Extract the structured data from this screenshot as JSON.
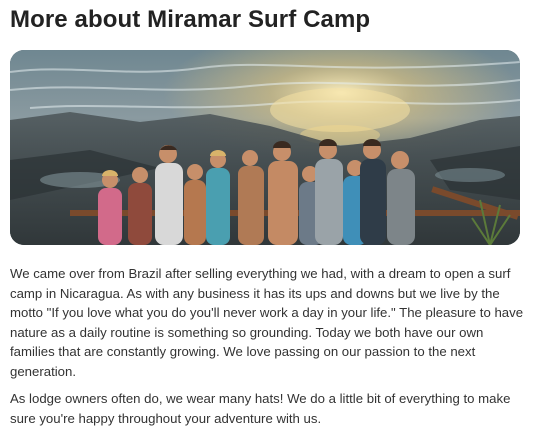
{
  "page": {
    "title": "More about Miramar Surf Camp"
  },
  "photo": {
    "subject": "group-photo"
  },
  "about": {
    "paragraphs": [
      "We came over from Brazil after selling everything we had, with a dream to open a surf camp in Nicaragua. As with any business it has its ups and downs but we live by the motto \"If you love what you do you'll never work a day in your life.\" The pleasure to have nature as a daily routine is something so grounding. Today we both have our own families that are constantly growing. We love passing on our passion to the next generation.",
      "As lodge owners often do, we wear many hats! We do a little bit of everything to make sure you're happy throughout your adventure with us."
    ]
  },
  "colors": {
    "text_primary": "#222222",
    "text_body": "#333333",
    "background": "#ffffff"
  }
}
